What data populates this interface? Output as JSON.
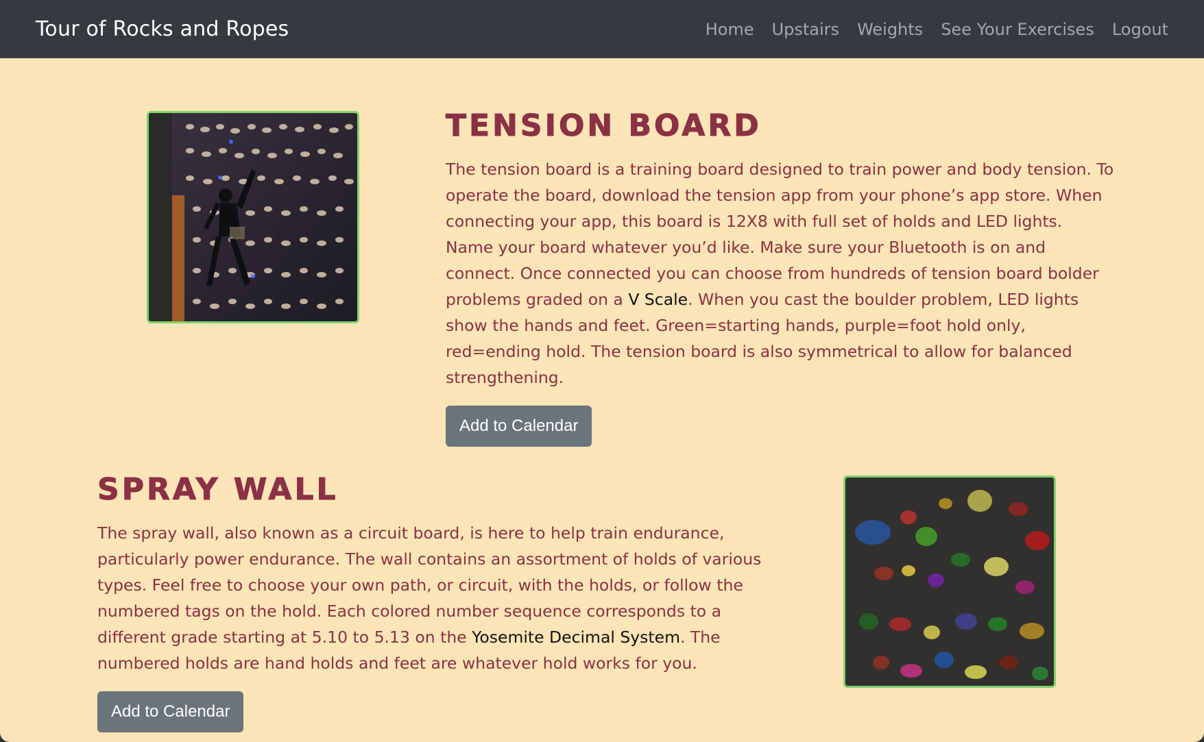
{
  "navbar": {
    "brand": "Tour of Rocks and Ropes",
    "links": [
      "Home",
      "Upstairs",
      "Weights",
      "See Your Exercises",
      "Logout"
    ]
  },
  "sections": [
    {
      "title": "TENSION BOARD",
      "text_before": "The tension board is a training board designed to train power and body tension. To operate the board, download the tension app from your phone’s app store. When connecting your app, this board is 12X8 with full set of holds and LED lights. Name your board whatever you’d like. Make sure your Bluetooth is on and connect. Once connected you can choose from hundreds of tension board bolder problems graded on a ",
      "term": "V Scale",
      "text_after": ". When you cast the boulder problem, LED lights show the hands and feet. Green=starting hands, purple=foot hold only, red=ending hold. The tension board is also symmetrical to allow for balanced strengthening.",
      "button": "Add to Calendar"
    },
    {
      "title": "SPRAY WALL",
      "text_before": "The spray wall, also known as a circuit board, is here to help train endurance, particularly power endurance. The wall contains an assortment of holds of various types. Feel free to choose your own path, or circuit, with the holds, or follow the numbered tags on the hold. Each colored number sequence corresponds to a different grade starting at 5.10 to 5.13 on the ",
      "term": "Yosemite Decimal System",
      "text_after": ". The numbered holds are hand holds and feet are whatever hold works for you.",
      "button": "Add to Calendar"
    }
  ],
  "colors": {
    "background": "#fbe4b6",
    "navbar": "#343a40",
    "heading": "#8a3145",
    "button": "#6b737b",
    "image_border": "#7fd36b"
  },
  "images": [
    "tension-board-photo",
    "spray-wall-photo"
  ]
}
